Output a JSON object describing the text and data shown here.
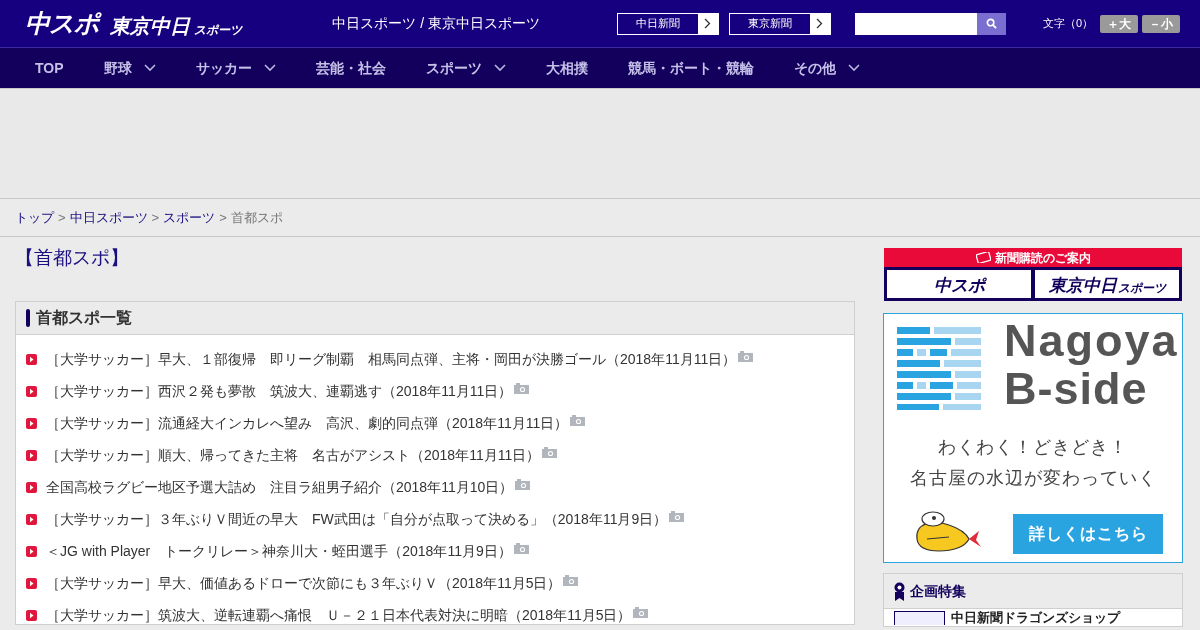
{
  "header": {
    "logo_main": "中スポ",
    "logo_sub": "東京中日",
    "logo_sub_small": "スポーツ",
    "tagline": "中日スポーツ / 東京中日スポーツ",
    "paper_links": [
      "中日新聞",
      "東京新聞"
    ],
    "font_size_label": "文字（0）",
    "font_buttons": [
      "＋大",
      "－小"
    ]
  },
  "nav": [
    {
      "label": "TOP",
      "dropdown": false
    },
    {
      "label": "野球",
      "dropdown": true
    },
    {
      "label": "サッカー",
      "dropdown": true
    },
    {
      "label": "芸能・社会",
      "dropdown": false
    },
    {
      "label": "スポーツ",
      "dropdown": true
    },
    {
      "label": "大相撲",
      "dropdown": false
    },
    {
      "label": "競馬・ボート・競輪",
      "dropdown": false
    },
    {
      "label": "その他",
      "dropdown": true
    }
  ],
  "breadcrumb": [
    {
      "label": "トップ",
      "kind": "link"
    },
    {
      "label": ">",
      "kind": "separator"
    },
    {
      "label": "中日スポーツ",
      "kind": "link"
    },
    {
      "label": ">",
      "kind": "separator"
    },
    {
      "label": "スポーツ",
      "kind": "link"
    },
    {
      "label": ">",
      "kind": "separator"
    },
    {
      "label": "首都スポ",
      "kind": "current"
    }
  ],
  "page_title": "【首都スポ】",
  "list": {
    "heading": "首都スポ一覧",
    "articles": [
      {
        "title": "［大学サッカー］早大、１部復帰　即リーグ制覇　相馬同点弾、主将・岡田が決勝ゴール（2018年11月11日）",
        "photo": true
      },
      {
        "title": "［大学サッカー］西沢２発も夢散　筑波大、連覇逃す（2018年11月11日）",
        "photo": true
      },
      {
        "title": "［大学サッカー］流通経大インカレへ望み　高沢、劇的同点弾（2018年11月11日）",
        "photo": true
      },
      {
        "title": "［大学サッカー］順大、帰ってきた主将　名古がアシスト（2018年11月11日）",
        "photo": true
      },
      {
        "title": "全国高校ラグビー地区予選大詰め　注目ラ組男子紹介（2018年11月10日）",
        "photo": true
      },
      {
        "title": "［大学サッカー］３年ぶりＶ間近の早大　FW武田は「自分が点取って決める」（2018年11月9日）",
        "photo": true
      },
      {
        "title": "＜JG with Player　トークリレー＞神奈川大・蛭田選手（2018年11月9日）",
        "photo": true
      },
      {
        "title": "［大学サッカー］早大、価値あるドローで次節にも３年ぶりＶ（2018年11月5日）",
        "photo": true
      },
      {
        "title": "［大学サッカー］筑波大、逆転連覇へ痛恨　Ｕ－２１日本代表対決に明暗（2018年11月5日）",
        "photo": true
      }
    ]
  },
  "sidebar": {
    "subscribe": {
      "heading": "新聞購読のご案内",
      "buttons": [
        "中スポ",
        "東京中日"
      ],
      "button_small": "スポーツ"
    },
    "banner": {
      "title_1": "Nagoya",
      "title_2": "B-side",
      "line_1": "わくわく！どきどき！",
      "line_2": "名古屋の水辺が変わっていく",
      "cta": "詳しくはこちら"
    },
    "features": {
      "heading": "企画特集",
      "items": [
        "中日新聞ドラゴンズショップ"
      ]
    }
  }
}
